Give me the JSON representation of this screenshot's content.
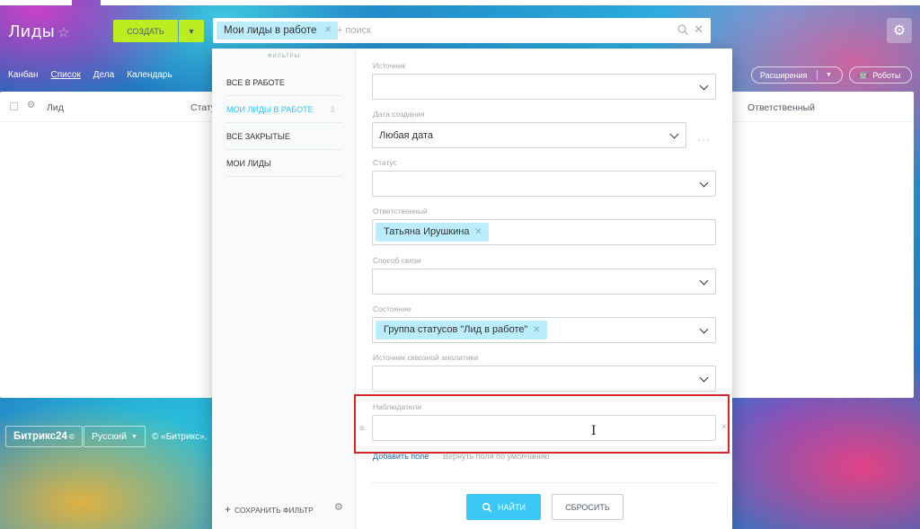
{
  "header": {
    "title": "Лиды",
    "create_label": "СОЗДАТЬ"
  },
  "search": {
    "active_filter": "Мои лиды в работе",
    "placeholder": "+ поиск"
  },
  "view_tabs": [
    "Канбан",
    "Список",
    "Дела",
    "Календарь"
  ],
  "toolbar": {
    "extensions_label": "Расширения",
    "robots_label": "Роботы"
  },
  "grid": {
    "columns": {
      "lead": "Лид",
      "status": "Стату",
      "responsible": "Ответственный"
    }
  },
  "footer": {
    "logo": "Битрикс24",
    "language": "Русский",
    "copyright": "© «Битрикс»,"
  },
  "filter_popup": {
    "presets_title": "ФИЛЬТРЫ",
    "presets": [
      {
        "label": "ВСЕ В РАБОТЕ",
        "active": false
      },
      {
        "label": "МОИ ЛИДЫ В РАБОТЕ",
        "active": true
      },
      {
        "label": "ВСЕ ЗАКРЫТЫЕ",
        "active": false
      },
      {
        "label": "МОИ ЛИДЫ",
        "active": false
      }
    ],
    "save_filter_label": "СОХРАНИТЬ ФИЛЬТР",
    "fields": {
      "source": {
        "label": "Источник",
        "value": ""
      },
      "created": {
        "label": "Дата создания",
        "value": "Любая дата"
      },
      "status": {
        "label": "Статус",
        "value": ""
      },
      "responsible": {
        "label": "Ответственный",
        "value": "Татьяна Ирушкина"
      },
      "contact": {
        "label": "Способ связи",
        "value": ""
      },
      "state": {
        "label": "Состояние",
        "value": "Группа статусов \"Лид в работе\""
      },
      "analytics": {
        "label": "Источник сквозной аналитики",
        "value": ""
      },
      "observers": {
        "label": "Наблюдатели",
        "value": ""
      }
    },
    "add_field_label": "Добавить поле",
    "restore_fields_label": "Вернуть поля по умолчанию",
    "find_label": "НАЙТИ",
    "reset_label": "СБРОСИТЬ"
  },
  "colors": {
    "accent": "#3bc8f5",
    "create_button": "#bbed21",
    "tag_bg": "#bcedfc",
    "highlight": "#d62728"
  }
}
